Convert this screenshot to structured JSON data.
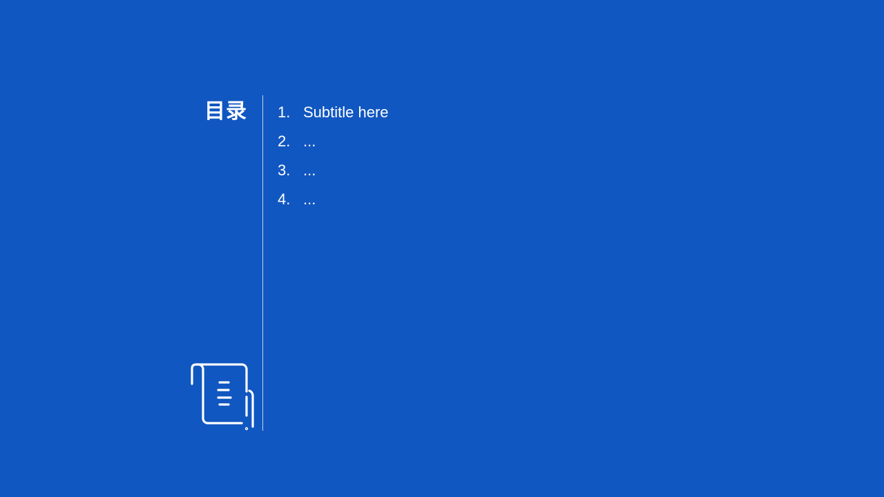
{
  "toc": {
    "title": "目录",
    "items": [
      {
        "number": "1.",
        "text": "Subtitle here"
      },
      {
        "number": "2.",
        "text": "..."
      },
      {
        "number": "3.",
        "text": "..."
      },
      {
        "number": "4.",
        "text": "..."
      }
    ]
  },
  "icons": {
    "bottom_left": "scroll-document-icon"
  },
  "colors": {
    "background": "#1157c1",
    "foreground": "#ffffff"
  }
}
